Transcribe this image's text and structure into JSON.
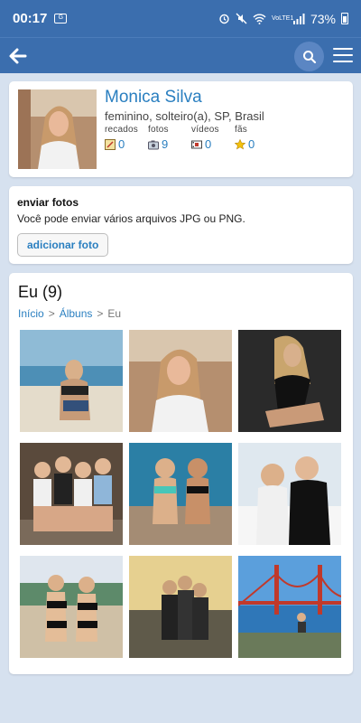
{
  "status": {
    "time": "00:17",
    "battery": "73%",
    "net": "VoLTE1"
  },
  "appbar": {
    "back": "back-arrow-icon",
    "search": "search-icon",
    "menu": "menu-icon"
  },
  "profile": {
    "name": "Monica Silva",
    "info": "feminino, solteiro(a), SP, Brasil",
    "stats": [
      {
        "label": "recados",
        "value": "0",
        "icon": "note-icon"
      },
      {
        "label": "fotos",
        "value": "9",
        "icon": "camera-icon"
      },
      {
        "label": "vídeos",
        "value": "0",
        "icon": "film-icon"
      },
      {
        "label": "fãs",
        "value": "0",
        "icon": "star-icon"
      }
    ]
  },
  "upload": {
    "title": "enviar fotos",
    "desc": "Você pode enviar vários arquivos JPG ou PNG.",
    "button": "adicionar foto"
  },
  "album": {
    "title": "Eu (9)",
    "breadcrumb": {
      "home": "Início",
      "albums": "Álbuns",
      "current": "Eu",
      "sep": ">"
    },
    "photos": 9
  },
  "colors": {
    "brand": "#3b6eae",
    "link": "#2a7fc0",
    "background": "#d6e1ef"
  }
}
